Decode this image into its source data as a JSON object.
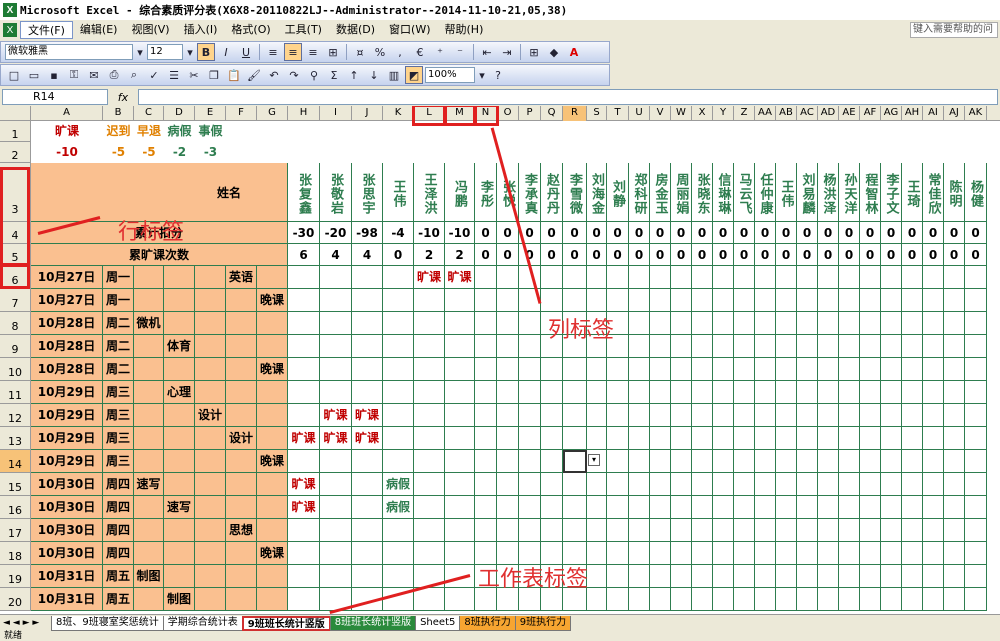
{
  "window": {
    "title": "Microsoft Excel - 综合素质评分表(X6X8-20110822LJ--Administrator--2014-11-10-21,05,38)"
  },
  "menu": {
    "items": [
      {
        "label": "文件(F)"
      },
      {
        "label": "编辑(E)"
      },
      {
        "label": "视图(V)"
      },
      {
        "label": "插入(I)"
      },
      {
        "label": "格式(O)"
      },
      {
        "label": "工具(T)"
      },
      {
        "label": "数据(D)"
      },
      {
        "label": "窗口(W)"
      },
      {
        "label": "帮助(H)"
      }
    ],
    "help_placeholder": "键入需要帮助的问"
  },
  "format_toolbar": {
    "font_name": "微软雅黑",
    "font_size": "12",
    "bold": "B",
    "italic": "I",
    "underline": "U",
    "percent": "%",
    "euro": "€",
    "zoom": "100%"
  },
  "formula_bar": {
    "name_box": "R14",
    "fx": "fx"
  },
  "columns": [
    "A",
    "B",
    "C",
    "D",
    "E",
    "F",
    "G",
    "H",
    "I",
    "J",
    "K",
    "L",
    "M",
    "N",
    "O",
    "P",
    "Q",
    "R",
    "S",
    "T",
    "U",
    "V",
    "W",
    "X",
    "Y",
    "Z",
    "AA",
    "AB",
    "AC",
    "AD",
    "AE",
    "AF",
    "AG",
    "AH",
    "AI",
    "AJ",
    "AK"
  ],
  "selected_column": "R",
  "rows": [
    "1",
    "2",
    "3",
    "4",
    "5",
    "6",
    "7",
    "8",
    "9",
    "10",
    "11",
    "12",
    "13",
    "14",
    "15",
    "16",
    "17",
    "18",
    "19",
    "20"
  ],
  "selected_row": "14",
  "summary": {
    "labels": [
      "旷课",
      "迟到",
      "早退",
      "病假",
      "事假"
    ],
    "values": [
      "-10",
      "-5",
      "-5",
      "-2",
      "-3"
    ]
  },
  "header": {
    "name_label": "姓名",
    "deduct_label": "累计扣分",
    "absent_label": "累旷课次数"
  },
  "students": [
    {
      "name": "张复鑫",
      "deduct": "-30",
      "absent": "6"
    },
    {
      "name": "张敬岩",
      "deduct": "-20",
      "absent": "4"
    },
    {
      "name": "张思宇",
      "deduct": "-98",
      "absent": "4"
    },
    {
      "name": "王伟",
      "deduct": "-4",
      "absent": "0"
    },
    {
      "name": "王泽洪",
      "deduct": "-10",
      "absent": "2"
    },
    {
      "name": "冯鹏",
      "deduct": "-10",
      "absent": "2"
    },
    {
      "name": "李彤",
      "deduct": "0",
      "absent": "0"
    },
    {
      "name": "张悦",
      "deduct": "0",
      "absent": "0"
    },
    {
      "name": "李承真",
      "deduct": "0",
      "absent": "0"
    },
    {
      "name": "赵丹丹",
      "deduct": "0",
      "absent": "0"
    },
    {
      "name": "李雪微",
      "deduct": "0",
      "absent": "0"
    },
    {
      "name": "刘海金",
      "deduct": "0",
      "absent": "0"
    },
    {
      "name": "刘静",
      "deduct": "0",
      "absent": "0"
    },
    {
      "name": "郑科研",
      "deduct": "0",
      "absent": "0"
    },
    {
      "name": "房金玉",
      "deduct": "0",
      "absent": "0"
    },
    {
      "name": "周丽娟",
      "deduct": "0",
      "absent": "0"
    },
    {
      "name": "张晓东",
      "deduct": "0",
      "absent": "0"
    },
    {
      "name": "信琳琳",
      "deduct": "0",
      "absent": "0"
    },
    {
      "name": "马云飞",
      "deduct": "0",
      "absent": "0"
    },
    {
      "name": "任仲康",
      "deduct": "0",
      "absent": "0"
    },
    {
      "name": "王伟",
      "deduct": "0",
      "absent": "0"
    },
    {
      "name": "刘易麟",
      "deduct": "0",
      "absent": "0"
    },
    {
      "name": "杨洪泽",
      "deduct": "0",
      "absent": "0"
    },
    {
      "name": "孙天洋",
      "deduct": "0",
      "absent": "0"
    },
    {
      "name": "程智林",
      "deduct": "0",
      "absent": "0"
    },
    {
      "name": "李子文",
      "deduct": "0",
      "absent": "0"
    },
    {
      "name": "王琦",
      "deduct": "0",
      "absent": "0"
    },
    {
      "name": "常佳欣",
      "deduct": "0",
      "absent": "0"
    },
    {
      "name": "陈明",
      "deduct": "0",
      "absent": "0"
    },
    {
      "name": "杨健",
      "deduct": "0",
      "absent": "0"
    }
  ],
  "schedule": [
    {
      "date": "10月27日",
      "day": "周一",
      "course": "英语",
      "course_col": 4,
      "marks": [
        {
          "s": 4,
          "t": "旷课"
        },
        {
          "s": 5,
          "t": "旷课"
        }
      ]
    },
    {
      "date": "10月27日",
      "day": "周一",
      "course": "晚课",
      "course_col": 5,
      "marks": []
    },
    {
      "date": "10月28日",
      "day": "周二",
      "course": "微机",
      "course_col": 1,
      "marks": []
    },
    {
      "date": "10月28日",
      "day": "周二",
      "course": "体育",
      "course_col": 2,
      "marks": []
    },
    {
      "date": "10月28日",
      "day": "周二",
      "course": "晚课",
      "course_col": 5,
      "marks": []
    },
    {
      "date": "10月29日",
      "day": "周三",
      "course": "心理",
      "course_col": 2,
      "marks": []
    },
    {
      "date": "10月29日",
      "day": "周三",
      "course": "设计",
      "course_col": 3,
      "marks": [
        {
          "s": 1,
          "t": "旷课"
        },
        {
          "s": 2,
          "t": "旷课"
        }
      ]
    },
    {
      "date": "10月29日",
      "day": "周三",
      "course": "设计",
      "course_col": 4,
      "marks": [
        {
          "s": 0,
          "t": "旷课"
        },
        {
          "s": 1,
          "t": "旷课"
        },
        {
          "s": 2,
          "t": "旷课"
        }
      ]
    },
    {
      "date": "10月29日",
      "day": "周三",
      "course": "晚课",
      "course_col": 5,
      "marks": []
    },
    {
      "date": "10月30日",
      "day": "周四",
      "course": "速写",
      "course_col": 1,
      "marks": [
        {
          "s": 0,
          "t": "旷课"
        },
        {
          "s": 3,
          "t": "病假"
        }
      ]
    },
    {
      "date": "10月30日",
      "day": "周四",
      "course": "速写",
      "course_col": 2,
      "marks": [
        {
          "s": 0,
          "t": "旷课"
        },
        {
          "s": 3,
          "t": "病假"
        }
      ]
    },
    {
      "date": "10月30日",
      "day": "周四",
      "course": "思想",
      "course_col": 4,
      "marks": []
    },
    {
      "date": "10月30日",
      "day": "周四",
      "course": "晚课",
      "course_col": 5,
      "marks": []
    },
    {
      "date": "10月31日",
      "day": "周五",
      "course": "制图",
      "course_col": 1,
      "marks": []
    },
    {
      "date": "10月31日",
      "day": "周五",
      "course": "制图",
      "course_col": 2,
      "marks": []
    }
  ],
  "annotations": {
    "row_label": "行标签",
    "col_label": "列标签",
    "sheet_label": "工作表标签"
  },
  "sheet_tabs": [
    {
      "label": "8班、9班寝室奖惩统计",
      "style": "normal"
    },
    {
      "label": "学期综合统计表",
      "style": "normal"
    },
    {
      "label": "9班班长统计竖版",
      "style": "active"
    },
    {
      "label": "8班班长统计竖版",
      "style": "green"
    },
    {
      "label": "Sheet5",
      "style": "normal"
    },
    {
      "label": "8班执行力",
      "style": "orange"
    },
    {
      "label": "9班执行力",
      "style": "orange"
    }
  ],
  "status": {
    "text": "就绪"
  },
  "colors": {
    "orange_fill": "#fac090",
    "grid_green": "#2e7d4f",
    "red": "#c00000",
    "annotation_red": "#e02020"
  }
}
